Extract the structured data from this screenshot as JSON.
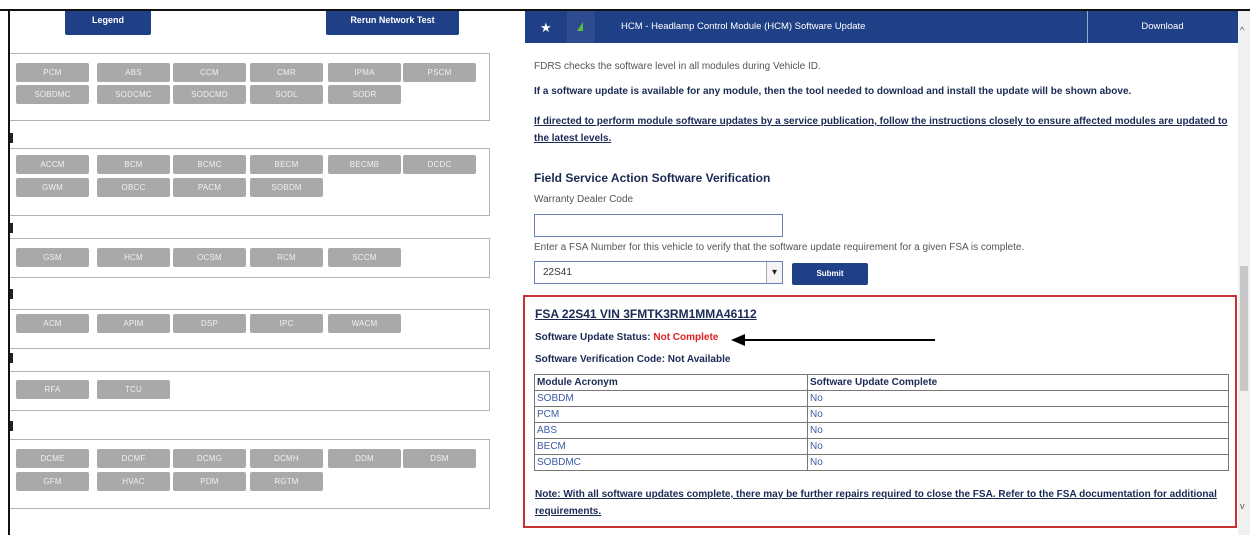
{
  "left_panel": {
    "legend_label": "Legend",
    "rerun_label": "Rerun Network Test",
    "groups": [
      {
        "modules": [
          "PCM",
          "ABS",
          "CCM",
          "CMR",
          "IPMA",
          "PSCM",
          "SOBDMC",
          "SODCMC",
          "SODCMD",
          "SODL",
          "SODR"
        ]
      },
      {
        "modules": [
          "ACCM",
          "BCM",
          "BCMC",
          "BECM",
          "BECMB",
          "DCDC",
          "GWM",
          "OBCC",
          "PACM",
          "SOBDM"
        ]
      },
      {
        "modules": [
          "GSM",
          "HCM",
          "OCSM",
          "RCM",
          "SCCM"
        ]
      },
      {
        "modules": [
          "ACM",
          "APIM",
          "DSP",
          "IPC",
          "WACM"
        ]
      },
      {
        "modules": [
          "RFA",
          "TCU"
        ]
      },
      {
        "modules": [
          "DCME",
          "DCMF",
          "DCMG",
          "DCMH",
          "DDM",
          "DSM",
          "GFM",
          "HVAC",
          "PDM",
          "RGTM"
        ]
      }
    ]
  },
  "header": {
    "title": "HCM - Headlamp Control Module (HCM) Software Update",
    "download_label": "Download",
    "icons": [
      "star-icon",
      "headlamp-icon"
    ]
  },
  "content": {
    "intro": "FDRS checks the software level in all modules during Vehicle ID.",
    "info": "If a software update is available for any module, then the tool needed to download and install the update will be shown above.",
    "directive": "If directed to perform module software updates by a service publication, follow the instructions closely to ensure affected modules are updated to the latest levels.",
    "fsa_title": "Field Service Action Software Verification",
    "dealer_label": "Warranty Dealer Code",
    "dealer_value": "",
    "fsa_prompt": "Enter a FSA Number for this vehicle to verify that the software update requirement for a given FSA is complete.",
    "fsa_selected": "22S41",
    "submit_label": "Submit"
  },
  "result": {
    "title": "FSA 22S41 VIN 3FMTK3RM1MMA46112",
    "status_label": "Software Update Status:",
    "status_value": "Not Complete",
    "code_text": "Software Verification Code: Not Available",
    "columns": [
      "Module Acronym",
      "Software Update Complete"
    ],
    "rows": [
      [
        "SOBDM",
        "No"
      ],
      [
        "PCM",
        "No"
      ],
      [
        "ABS",
        "No"
      ],
      [
        "BECM",
        "No"
      ],
      [
        "SOBDMC",
        "No"
      ]
    ],
    "note": "Note: With all software updates complete, there may be further repairs required to close the FSA. Refer to the FSA documentation for additional requirements."
  },
  "colors": {
    "header_blue": "#1f3f86",
    "status_red": "#e02020",
    "box_border": "#c83232",
    "module_gray": "#a9a9a9"
  }
}
